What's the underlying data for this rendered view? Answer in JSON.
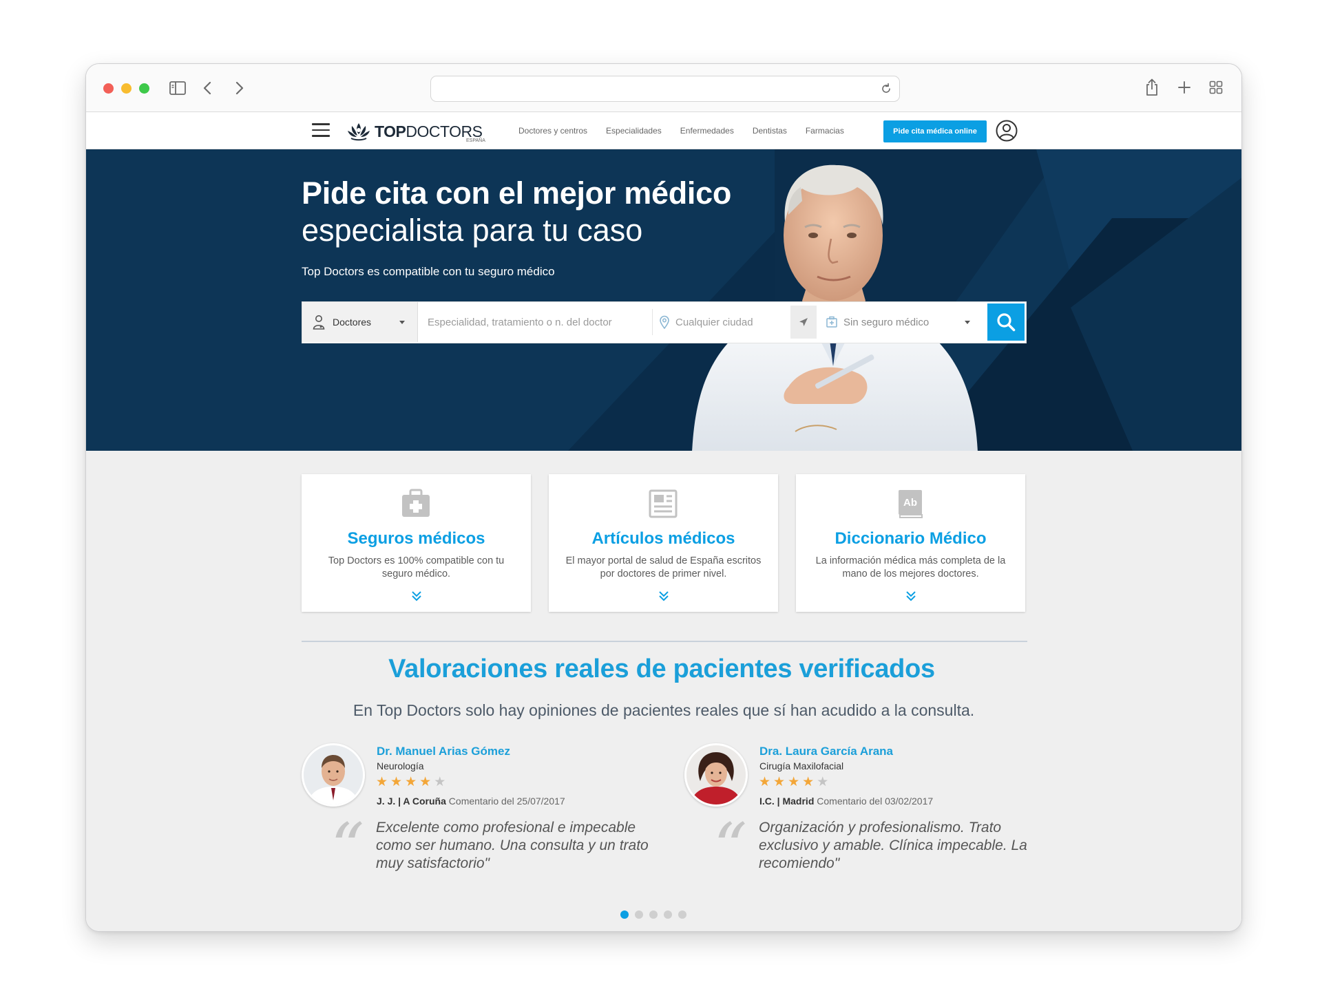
{
  "site": {
    "logo_text_bold": "TOP",
    "logo_text_rest": "DOCTORS",
    "logo_sub": "ESPAÑA",
    "nav": [
      "Doctores y centros",
      "Especialidades",
      "Enfermedades",
      "Dentistas",
      "Farmacias"
    ],
    "cta": "Pide cita médica online"
  },
  "hero": {
    "title_line1": "Pide cita con el mejor médico",
    "title_line2": "especialista para tu caso",
    "subtitle": "Top Doctors es compatible con tu seguro médico"
  },
  "search": {
    "type_label": "Doctores",
    "specialty_placeholder": "Especialidad, tratamiento o n. del doctor",
    "city_placeholder": "Cualquier ciudad",
    "insurance_label": "Sin seguro médico"
  },
  "cards": [
    {
      "icon": "first-aid-kit-icon",
      "title": "Seguros médicos",
      "desc": "Top Doctors es 100% compatible con tu seguro médico."
    },
    {
      "icon": "newspaper-icon",
      "title": "Artículos médicos",
      "desc": "El mayor portal de salud de España escritos por doctores de primer nivel."
    },
    {
      "icon": "dictionary-book-icon",
      "title": "Diccionario Médico",
      "desc": "La información médica más completa de la mano de los mejores doctores."
    }
  ],
  "reviews_section": {
    "title": "Valoraciones reales de pacientes verificados",
    "subtitle": "En Top Doctors solo hay opiniones de pacientes reales que sí han acudido a la consulta."
  },
  "reviews": [
    {
      "name": "Dr. Manuel Arias Gómez",
      "specialty": "Neurología",
      "rating": 4,
      "author": "J. J. | A Coruña",
      "date_text": "Comentario del 25/07/2017",
      "quote": "Excelente como profesional e impecable como ser humano. Una consulta y un trato muy satisfactorio\""
    },
    {
      "name": "Dra. Laura García Arana",
      "specialty": "Cirugía Maxilofacial",
      "rating": 4,
      "author": "I.C. | Madrid",
      "date_text": "Comentario del 03/02/2017",
      "quote": "Organización y profesionalismo. Trato exclusivo y amable. Clínica impecable. La recomiendo\""
    }
  ],
  "carousel": {
    "count": 5,
    "active": 1
  },
  "colors": {
    "brand_blue": "#0b9fe3",
    "hero_navy": "#0d3556",
    "star": "#f3a638",
    "star_off": "#c4c4c4"
  }
}
